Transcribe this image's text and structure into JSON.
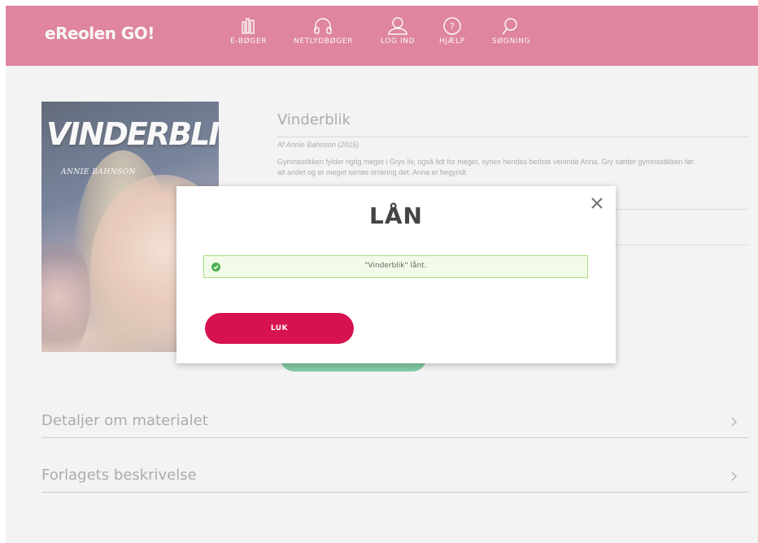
{
  "header": {
    "logo": "eReolen GO!",
    "bg_color": "#d94f75",
    "nav": [
      {
        "label": "E-BØGER",
        "icon": "books-icon"
      },
      {
        "label": "NETLYDBØGER",
        "icon": "headphones-icon"
      },
      {
        "label": "LOG IND",
        "icon": "user-icon"
      },
      {
        "label": "HJÆLP",
        "icon": "help-icon"
      },
      {
        "label": "SØGNING",
        "icon": "search-icon"
      }
    ]
  },
  "book": {
    "cover_title": "VINDERBLIK",
    "cover_author": "ANNIE BAHNSON",
    "title": "Vinderblik",
    "author_line": "Af Annie Bahnson (2015)",
    "description": "Gymnastikken fylder rigtig meget i Grys liv, også lidt for meget, synes hendes bedste veninde Anna. Gry sætter gymnastikken før alt andet og er meget seriøs omkring det. Anna er begyndt"
  },
  "sections": [
    {
      "label": "Detaljer om materialet"
    },
    {
      "label": "Forlagets beskrivelse"
    }
  ],
  "modal": {
    "title": "LÅN",
    "message": "\"Vinderblik\" lånt.",
    "button_label": "LUK",
    "accent_color": "#d6124f",
    "success_color": "#4caf50"
  }
}
